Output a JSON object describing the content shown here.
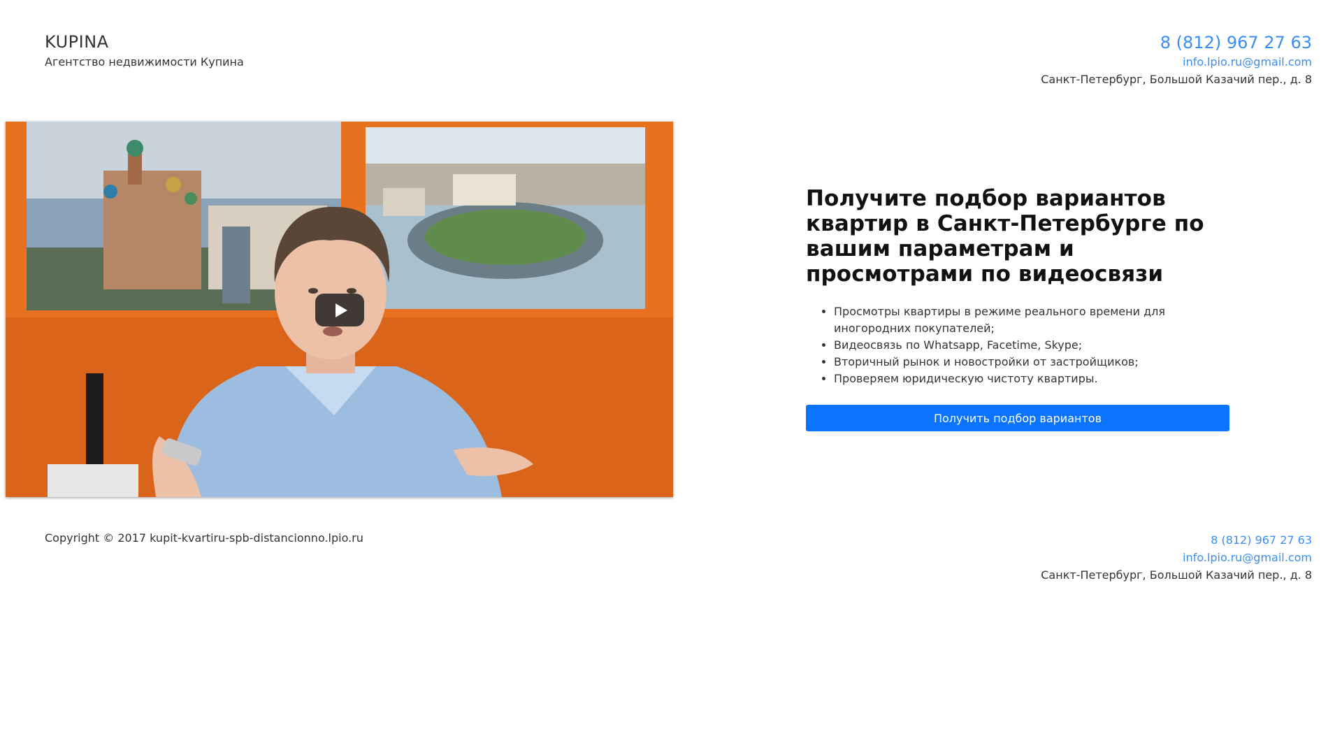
{
  "header": {
    "brand": "KUPINA",
    "tagline": "Агентство недвижимости Купина",
    "phone": "8 (812) 967 27 63",
    "email": "info.lpio.ru@gmail.com",
    "address": "Санкт-Петербург, Большой Казачий пер., д. 8"
  },
  "video": {
    "play_icon": "play-icon"
  },
  "offer": {
    "title": "Получите подбор вариантов квартир в Санкт-Петербурге по вашим параметрам и просмотрами по видеосвязи",
    "benefits": [
      "Просмотры квартиры в режиме реального времени для иногородних покупателей;",
      "Видеосвязь по Whatsapp, Facetime, Skype;",
      "Вторичный рынок и новостройки от застройщиков;",
      "Проверяем юридическую чистоту квартиры."
    ],
    "cta_label": "Получить подбор вариантов"
  },
  "footer": {
    "copyright": "Copyright © 2017 kupit-kvartiru-spb-distancionno.lpio.ru",
    "phone": "8 (812) 967 27 63",
    "email": "info.lpio.ru@gmail.com",
    "address": "Санкт-Петербург, Большой Казачий пер., д. 8"
  },
  "colors": {
    "accent": "#3a8ef0",
    "button": "#0a74ff",
    "wall": "#e8711f"
  }
}
